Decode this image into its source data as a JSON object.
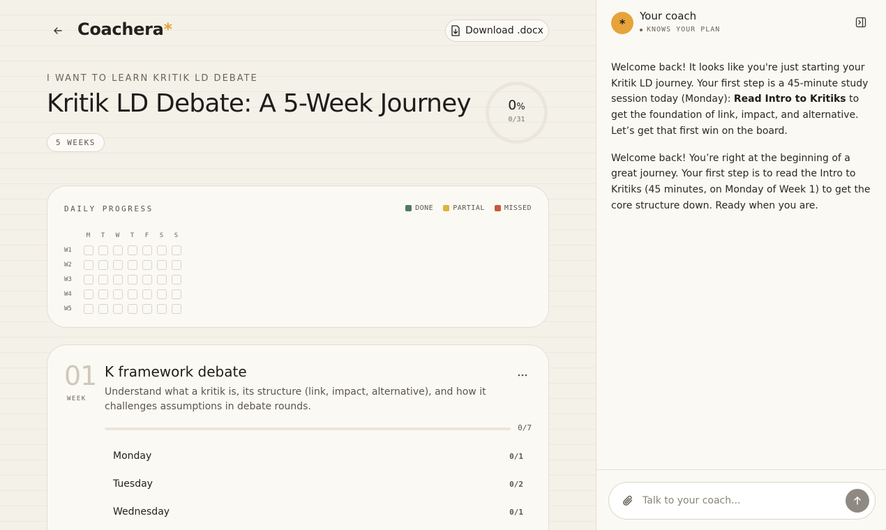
{
  "app": {
    "brand_name": "Coachera",
    "brand_mark": "*",
    "accent_color": "#e6a33a",
    "download_label": "Download .docx"
  },
  "plan": {
    "eyebrow": "I WANT TO LEARN KRITIK LD DEBATE",
    "title": "Kritik LD Debate: A 5-Week Journey",
    "weeks_badge": "5 WEEKS",
    "progress_percent": "0",
    "progress_percent_sign": "%",
    "progress_fraction": 0,
    "progress_count": "0/31"
  },
  "daily_progress": {
    "label": "DAILY PROGRESS",
    "legend": [
      {
        "label": "DONE",
        "color": "#4f7a5e"
      },
      {
        "label": "PARTIAL",
        "color": "#e0b43c"
      },
      {
        "label": "MISSED",
        "color": "#c8593a"
      }
    ],
    "day_labels": [
      "M",
      "T",
      "W",
      "T",
      "F",
      "S",
      "S"
    ],
    "weeks": [
      {
        "label": "W1",
        "days": [
          "empty",
          "empty",
          "empty",
          "empty",
          "empty",
          "empty",
          "empty"
        ]
      },
      {
        "label": "W2",
        "days": [
          "empty",
          "empty",
          "empty",
          "empty",
          "empty",
          "empty",
          "empty"
        ]
      },
      {
        "label": "W3",
        "days": [
          "empty",
          "empty",
          "empty",
          "empty",
          "empty",
          "empty",
          "empty"
        ]
      },
      {
        "label": "W4",
        "days": [
          "empty",
          "empty",
          "empty",
          "empty",
          "empty",
          "empty",
          "empty"
        ]
      },
      {
        "label": "W5",
        "days": [
          "empty",
          "empty",
          "empty",
          "empty",
          "empty",
          "empty",
          "empty"
        ]
      }
    ]
  },
  "week_card": {
    "number": "01",
    "word": "WEEK",
    "title": "K framework debate",
    "description": "Understand what a kritik is, its structure (link, impact, alternative), and how it challenges assumptions in debate rounds.",
    "progress_fraction": 0,
    "count": "0/7",
    "days": [
      {
        "name": "Monday",
        "count": "0/1"
      },
      {
        "name": "Tuesday",
        "count": "0/2"
      },
      {
        "name": "Wednesday",
        "count": "0/1"
      }
    ]
  },
  "coach": {
    "avatar_glyph": "*",
    "name": "Your coach",
    "status": "KNOWS YOUR PLAN",
    "messages": [
      {
        "before": "Welcome back! It looks like you're just starting your Kritik LD journey. Your first step is a 45-minute study session today (Monday): ",
        "bold": "Read Intro to Kritiks",
        "after": " to get the foundation of link, impact, and alternative. Let’s get that first win on the board."
      },
      {
        "before": "Welcome back! You’re right at the beginning of a great journey. Your first step is to read the Intro to Kritiks (45 minutes, on Monday of Week 1) to get the core structure down. Ready when you are.",
        "bold": "",
        "after": ""
      }
    ],
    "input_placeholder": "Talk to your coach..."
  }
}
